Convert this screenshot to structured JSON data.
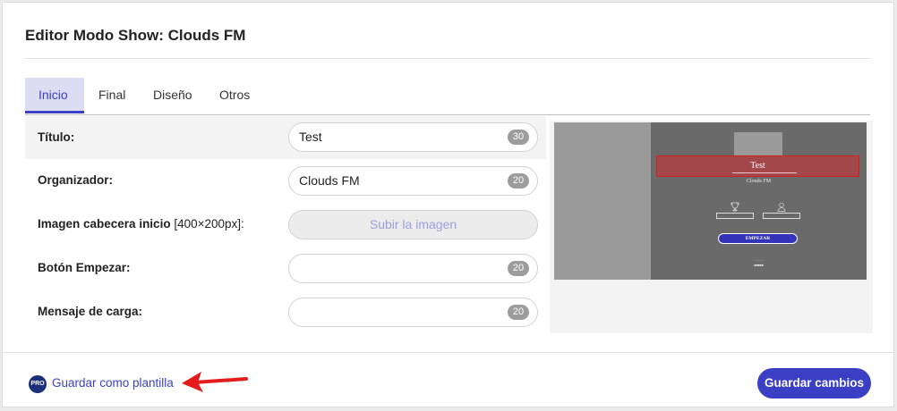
{
  "modal": {
    "title": "Editor Modo Show: Clouds FM"
  },
  "tabs": [
    {
      "label": "Inicio",
      "active": true
    },
    {
      "label": "Final",
      "active": false
    },
    {
      "label": "Diseño",
      "active": false
    },
    {
      "label": "Otros",
      "active": false
    }
  ],
  "form": {
    "titulo": {
      "label": "Título:",
      "value": "Test",
      "count": "30"
    },
    "organizador": {
      "label": "Organizador:",
      "value": "Clouds FM",
      "count": "20"
    },
    "imagen": {
      "label": "Imagen cabecera inicio",
      "hint": "[400×200px]:",
      "button": "Subir la imagen"
    },
    "boton": {
      "label": "Botón Empezar:",
      "value": "",
      "count": "20"
    },
    "mensaje": {
      "label": "Mensaje de carga:",
      "value": "",
      "count": "20"
    }
  },
  "preview": {
    "title": "Test",
    "organizer": "Clouds FM",
    "start_button": "EMPEZAR",
    "icons": [
      "trophy-icon",
      "user-icon"
    ]
  },
  "footer": {
    "pro_badge": "PRO",
    "save_template": "Guardar como plantilla",
    "save_changes": "Guardar cambios"
  },
  "colors": {
    "accent": "#3a3fc4",
    "pro": "#1c2f7a",
    "arrow": "#e51c1c",
    "preview_title_bg": "#a4474b"
  }
}
